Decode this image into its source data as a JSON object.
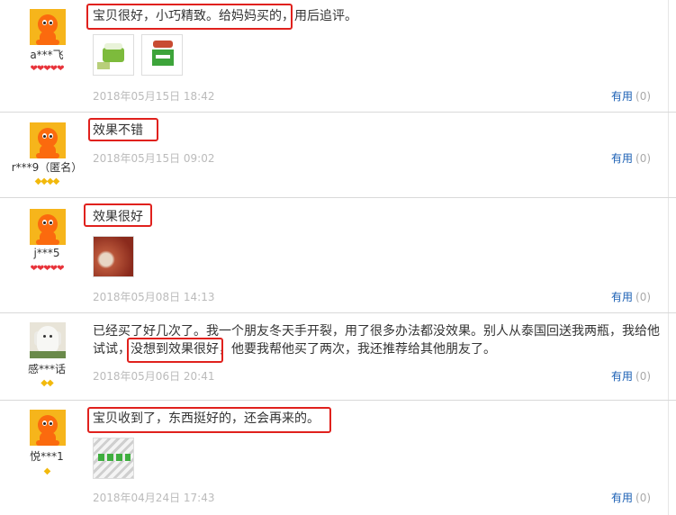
{
  "colors": {
    "highlight": "#e0211d",
    "useful_link": "#1a5fb4",
    "date": "#bbbbbb",
    "heart": "#e8343b",
    "diamond": "#f2b90c"
  },
  "reviews": [
    {
      "user": "a***飞",
      "badges": "❤❤❤❤❤",
      "avatar": "orange-mascot-icon",
      "text_highlight": "宝贝很好，小巧精致。给妈妈买的，",
      "text_rest": "用后追评。",
      "images": [
        "green-jar-photo",
        "green-jar-box-photo"
      ],
      "date": "2018年05月15日 18:42",
      "useful_label": "有用",
      "useful_count": "(0)"
    },
    {
      "user": "r***9（匿名）",
      "badges": "◆◆◆◆",
      "avatar": "orange-mascot-icon",
      "text_highlight": "效果不错",
      "text_rest": "",
      "images": [],
      "date": "2018年05月15日 09:02",
      "useful_label": "有用",
      "useful_count": "(0)"
    },
    {
      "user": "j***5",
      "badges": "❤❤❤❤❤",
      "avatar": "orange-mascot-icon",
      "text_highlight": "效果很好",
      "text_rest": "",
      "images": [
        "jar-closeup-photo"
      ],
      "date": "2018年05月08日 14:13",
      "useful_label": "有用",
      "useful_count": "(0)"
    },
    {
      "user": "感***话",
      "badges": "◆◆",
      "avatar": "dog-photo-icon",
      "text_line1": "已经买了好几次了。我一个朋友冬天手开裂，用了很多办法都没效果。别人从泰国回送我两瓶，我给他",
      "text_line2_pre": "试试，",
      "text_line2_hl": "没想到效果很好",
      "text_line2_post": "，他要我帮他买了两次，我还推荐给其他朋友了。",
      "images": [],
      "date": "2018年05月06日 20:41",
      "useful_label": "有用",
      "useful_count": "(0)"
    },
    {
      "user": "悦***1",
      "badges": "◆",
      "avatar": "orange-mascot-icon",
      "text_highlight": "宝贝收到了，东西挺好的，还会再来的。",
      "text_rest": "",
      "images": [
        "jars-in-box-photo"
      ],
      "date": "2018年04月24日 17:43",
      "useful_label": "有用",
      "useful_count": "(0)"
    }
  ]
}
